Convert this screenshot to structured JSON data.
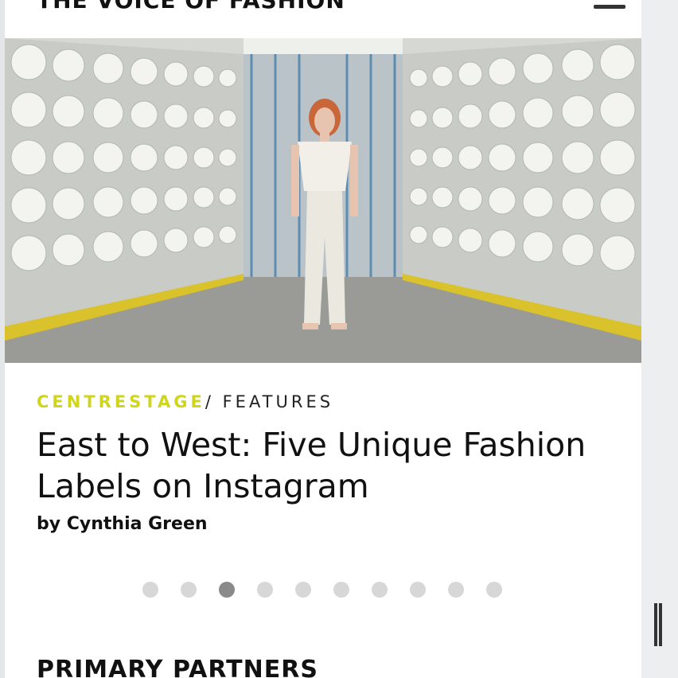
{
  "header": {
    "logo_text": "THE VOICE OF FASHION",
    "menu_icon": "hamburger-menu-icon"
  },
  "article": {
    "hero_image_alt": "Model in white outfit standing between walls of white yarn spools in a textile mill",
    "category_primary": "CENTRESTAGE",
    "category_separator": "/",
    "category_secondary": "FEATURES",
    "title": "East to West: Five Unique Fashion Labels on Instagram",
    "byline": "by Cynthia Green"
  },
  "carousel": {
    "dot_count": 10,
    "active_index": 2
  },
  "partners": {
    "heading": "PRIMARY PARTNERS"
  },
  "colors": {
    "category_accent": "#cfd51c",
    "text": "#111111",
    "dot_inactive": "#d7d7d7",
    "dot_active": "#8a8a8a"
  }
}
